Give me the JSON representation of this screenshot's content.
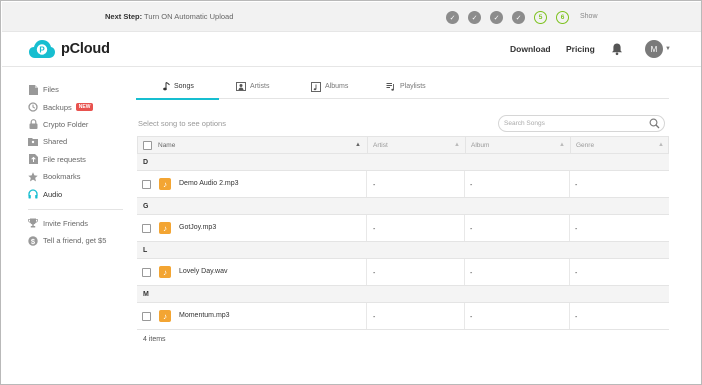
{
  "banner": {
    "next_step_label": "Next Step:",
    "next_step_text": "Turn ON Automatic Upload",
    "steps": [
      {
        "state": "done",
        "text": "✓"
      },
      {
        "state": "done",
        "text": "✓"
      },
      {
        "state": "done",
        "text": "✓"
      },
      {
        "state": "done",
        "text": "✓"
      },
      {
        "state": "todo",
        "text": "5"
      },
      {
        "state": "todo",
        "text": "6"
      }
    ],
    "show_label": "Show"
  },
  "header": {
    "logo_text": "pCloud",
    "download_label": "Download",
    "pricing_label": "Pricing",
    "avatar_initial": "M"
  },
  "sidebar": {
    "items": [
      {
        "label": "Files",
        "icon": "file-icon"
      },
      {
        "label": "Backups",
        "icon": "backup-icon",
        "badge": "NEW"
      },
      {
        "label": "Crypto Folder",
        "icon": "lock-icon"
      },
      {
        "label": "Shared",
        "icon": "shared-folder-icon"
      },
      {
        "label": "File requests",
        "icon": "file-request-icon"
      },
      {
        "label": "Bookmarks",
        "icon": "star-icon"
      },
      {
        "label": "Audio",
        "icon": "headphones-icon",
        "active": true
      }
    ],
    "extra": [
      {
        "label": "Invite Friends",
        "icon": "trophy-icon"
      },
      {
        "label": "Tell a friend, get $5",
        "icon": "dollar-icon"
      }
    ]
  },
  "tabs": [
    {
      "label": "Songs",
      "icon": "note-icon",
      "active": true
    },
    {
      "label": "Artists",
      "icon": "artist-icon"
    },
    {
      "label": "Albums",
      "icon": "album-icon"
    },
    {
      "label": "Playlists",
      "icon": "playlist-icon"
    }
  ],
  "toolbar": {
    "hint": "Select song to see options",
    "search_placeholder": "Search Songs"
  },
  "table": {
    "columns": [
      "Name",
      "Artist",
      "Album",
      "Genre"
    ],
    "groups": [
      {
        "letter": "D",
        "name": "Demo Audio 2.mp3",
        "artist": "-",
        "album": "-",
        "genre": "-"
      },
      {
        "letter": "G",
        "name": "GotJoy.mp3",
        "artist": "-",
        "album": "-",
        "genre": "-"
      },
      {
        "letter": "L",
        "name": "Lovely Day.wav",
        "artist": "-",
        "album": "-",
        "genre": "-"
      },
      {
        "letter": "M",
        "name": "Momentum.mp3",
        "artist": "-",
        "album": "-",
        "genre": "-"
      }
    ],
    "footer": "4 items"
  },
  "colors": {
    "accent": "#17bed0",
    "step_todo": "#7dc21e",
    "file_icon": "#f3a533",
    "badge": "#e8524e"
  }
}
